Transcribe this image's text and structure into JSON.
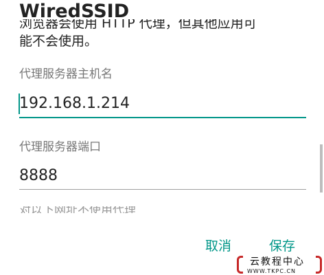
{
  "dialog": {
    "title": "WiredSSID",
    "description_line1": "浏览器会使用 HTTP 代理，但其他应用可",
    "description_line2": "能不会使用。",
    "proxy_hostname_label": "代理服务器主机名",
    "proxy_hostname_value": "192.168.1.214",
    "proxy_port_label": "代理服务器端口",
    "proxy_port_value": "8888",
    "bypass_label": "对以下网址不使用代理",
    "cancel_label": "取消",
    "save_label": "保存"
  },
  "watermark": {
    "text": "云教程中心",
    "sub": "WWW.TKPC.CN"
  },
  "colors": {
    "accent": "#009688",
    "watermark_red": "#c62828"
  }
}
